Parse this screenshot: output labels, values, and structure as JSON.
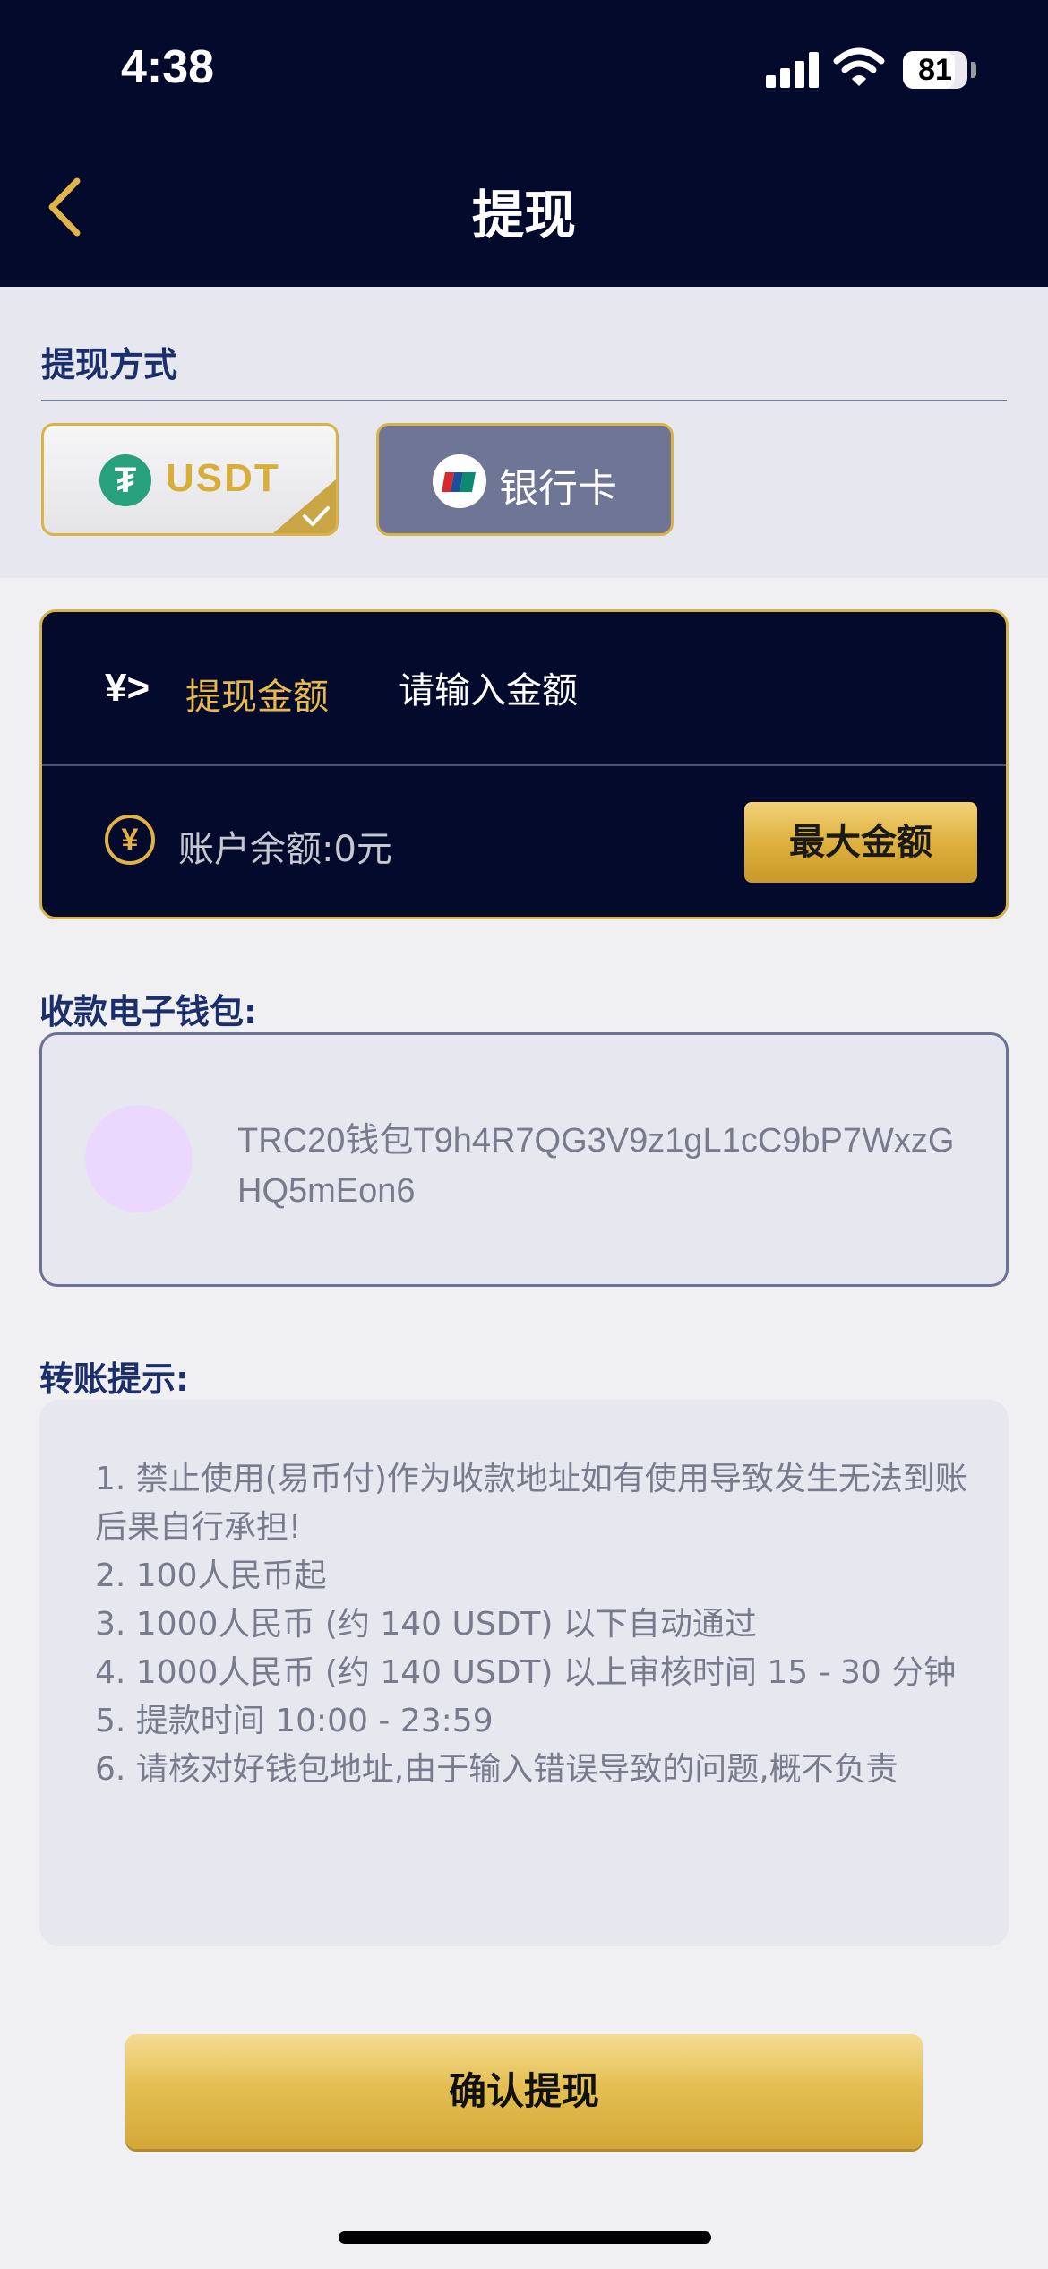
{
  "status_bar": {
    "time": "4:38",
    "battery": "81"
  },
  "header": {
    "title": "提现"
  },
  "withdraw_method": {
    "label": "提现方式",
    "options": [
      {
        "label": "USDT",
        "selected": true,
        "icon": "tether-icon"
      },
      {
        "label": "银行卡",
        "selected": false,
        "icon": "unionpay-icon"
      }
    ]
  },
  "amount": {
    "prefix_icon": "¥>",
    "label": "提现金额",
    "placeholder": "请输入金额",
    "balance_label": "账户余额:0元",
    "max_button": "最大金额"
  },
  "wallet": {
    "label": "收款电子钱包:",
    "text": "TRC20钱包T9h4R7QG3V9z1gL1cC9bP7WxzGHQ5mEon6"
  },
  "tips": {
    "label": "转账提示:",
    "items": [
      "1. 禁止使用(易币付)作为收款地址如有使用导致发生无法到账后果自行承担!",
      "2. 100人民币起",
      "3. 1000人民币 (约 140 USDT) 以下自动通过",
      "4. 1000人民币 (约 140 USDT) 以上审核时间 15 - 30 分钟",
      "5. 提款时间 10:00 - 23:59",
      "6. 请核对好钱包地址,由于输入错误导致的问题,概不负责"
    ]
  },
  "confirm_button": "确认提现",
  "colors": {
    "navy": "#030a2b",
    "gold": "#d9b248",
    "label_blue": "#1b2f6b",
    "tether_green": "#26a17b",
    "bank_button": "#6f7595"
  }
}
